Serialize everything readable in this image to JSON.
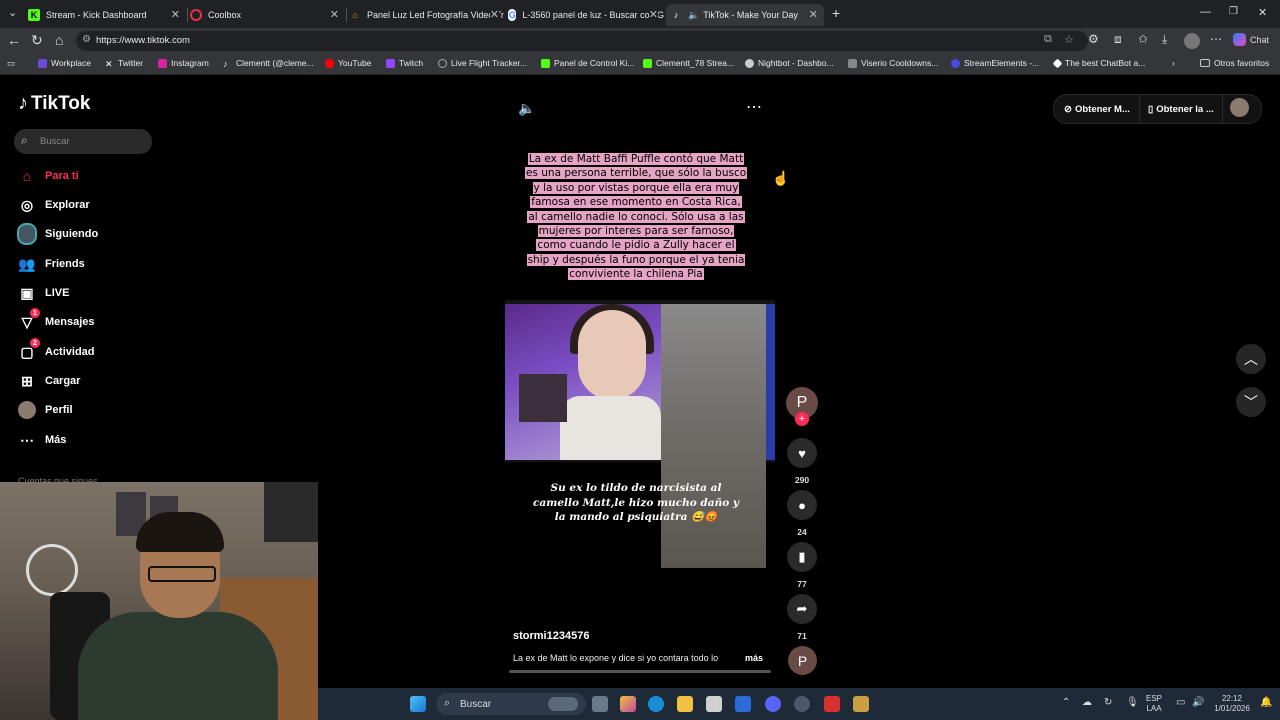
{
  "tabs": [
    {
      "title": "Stream - Kick Dashboard",
      "icon": "kick-icon",
      "color": "#53fc18"
    },
    {
      "title": "Coolbox",
      "icon": "coolbox-icon",
      "color": "#e8304a"
    },
    {
      "title": "Panel Luz Led Fotografía Video Tr",
      "icon": "shop-icon",
      "color": "#f08a24"
    },
    {
      "title": "L-3560 panel de luz - Buscar con G",
      "icon": "google-icon",
      "color": "#ffffff"
    },
    {
      "title": "TikTok - Make Your Day",
      "icon": "tiktok-icon",
      "color": "#ffffff"
    }
  ],
  "address": {
    "url": "https://www.tiktok.com"
  },
  "chat_label": "Chat",
  "bookmarks": [
    {
      "label": "Workplace",
      "color": "#6c4ad8"
    },
    {
      "label": "Twitter",
      "color": "#000000"
    },
    {
      "label": "Instagram",
      "color": "#d6249f"
    },
    {
      "label": "Clementt (@cleme...",
      "color": "#000000"
    },
    {
      "label": "YouTube",
      "color": "#ff0000"
    },
    {
      "label": "Twitch",
      "color": "#9146ff"
    },
    {
      "label": "Live Flight Tracker...",
      "color": "#888888"
    },
    {
      "label": "Panel de Control Ki...",
      "color": "#53fc18"
    },
    {
      "label": "Clementt_78 Strea...",
      "color": "#53fc18"
    },
    {
      "label": "Nightbot - Dashbo...",
      "color": "#cccccc"
    },
    {
      "label": "Viserio Cooldowns...",
      "color": "#888888"
    },
    {
      "label": "StreamElements -...",
      "color": "#4a4ae8"
    },
    {
      "label": "The best ChatBot a...",
      "color": "#ffffff"
    }
  ],
  "other_bookmarks": "Otros favoritos",
  "sidebar": {
    "logo": "TikTok",
    "search_placeholder": "Buscar",
    "items": [
      {
        "label": "Para ti",
        "icon": "home-icon"
      },
      {
        "label": "Explorar",
        "icon": "compass-icon"
      },
      {
        "label": "Siguiendo",
        "icon": "following-icon"
      },
      {
        "label": "Friends",
        "icon": "friends-icon"
      },
      {
        "label": "LIVE",
        "icon": "live-icon"
      },
      {
        "label": "Mensajes",
        "icon": "messages-icon",
        "badge": "1"
      },
      {
        "label": "Actividad",
        "icon": "activity-icon",
        "badge": "2"
      },
      {
        "label": "Cargar",
        "icon": "upload-icon"
      },
      {
        "label": "Perfil",
        "icon": "profile-icon"
      },
      {
        "label": "Más",
        "icon": "more-icon"
      }
    ],
    "following_heading": "Cuentas que sigues"
  },
  "header": {
    "btn1": "Obtener M...",
    "btn2": "Obtener la ..."
  },
  "video": {
    "caption": "La ex de Matt Baffi Puffle contó que Matt es una persona terrible, que sólo la busco y la uso por vistas porque ella era muy famosa en ese momento en Costa Rica, al camello nadie lo conoci. Sólo usa a las mujeres por interes para ser famoso, como cuando le pidio a Zully hacer el ship y después la funo porque el ya tenia conviviente la chilena Pia",
    "subtitle": "Su ex lo tildo de narcisista al camello Matt,le hizo mucho daño y la mando al psiquiatra 😅😡",
    "username": "stormi1234576",
    "description": "La ex de Matt lo expone y dice si yo contara todo lo",
    "more_label": "más",
    "creator_initial": "P",
    "likes": "290",
    "comments": "24",
    "saves": "77",
    "shares": "71"
  },
  "taskbar": {
    "search": "Buscar",
    "lang1": "ESP",
    "lang2": "LAA",
    "time": "22:12",
    "date": "1/01/2026"
  }
}
